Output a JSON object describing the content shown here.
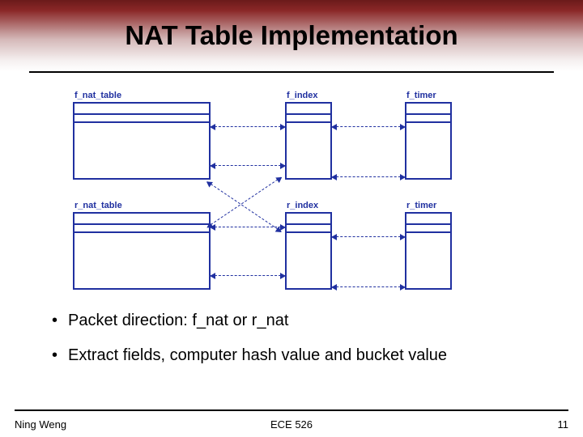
{
  "title": "NAT Table Implementation",
  "diagram": {
    "top": {
      "nat_label": "f_nat_table",
      "index_label": "f_index",
      "timer_label": "f_timer"
    },
    "bottom": {
      "nat_label": "r_nat_table",
      "index_label": "r_index",
      "timer_label": "r_timer"
    }
  },
  "bullets": [
    "Packet direction: f_nat or r_nat",
    "Extract fields, computer hash value and bucket value"
  ],
  "footer": {
    "author": "Ning Weng",
    "course": "ECE 526",
    "page": "11"
  }
}
